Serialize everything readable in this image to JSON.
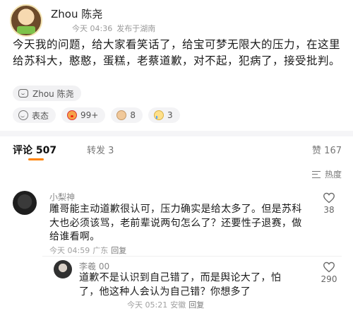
{
  "post": {
    "author": "Zhou 陈尧",
    "time": "今天 04:36",
    "location": "发布于湖南",
    "text": "今天我的问题，给大家看笑话了，给宝可梦无限大的压力，在这里给苏科大，憨憨，蛋糕，老蔡道歉，对不起，犯病了，接受批判。",
    "chip_label": "Zhou 陈尧"
  },
  "reactions": [
    {
      "icon": "smile-icon",
      "label": "表态"
    },
    {
      "icon": "clown-emoji-icon",
      "label": "99+"
    },
    {
      "icon": "doge-emoji-icon",
      "label": "8"
    },
    {
      "icon": "cry-emoji-icon",
      "label": "3"
    }
  ],
  "tabs": {
    "comments": "评论 507",
    "reposts": "转发 3",
    "likes": "赞 167"
  },
  "sort": {
    "label": "热度"
  },
  "comments": [
    {
      "user": "小梨神",
      "text": "雕哥能主动道歉很认可，压力确实是给太多了。但是苏科大也必须该骂，老前辈说两句怎么了？还要性子退赛，做给谁看啊。",
      "time": "今天 04:59",
      "location": "广东",
      "reply": "回复",
      "likes": "38"
    },
    {
      "user": "李羲 00",
      "text": "道歉不是认识到自己错了，而是舆论大了，怕了，他这种人会认为自己错？你想多了",
      "time": "今天 05:21",
      "location": "安徽",
      "reply": "回复",
      "likes": "290"
    }
  ],
  "colors": {
    "accent": "#ff8200",
    "text": "#1a1a1a",
    "muted": "#9a9a9a"
  }
}
